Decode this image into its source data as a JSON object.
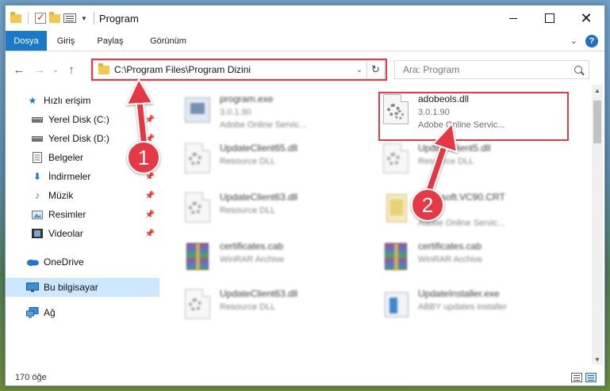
{
  "window": {
    "title": "Program",
    "controls": {
      "minimize": "",
      "maximize": "",
      "close": "✕"
    }
  },
  "ribbon": {
    "tabs": [
      "Dosya",
      "Giriş",
      "Paylaş",
      "Görünüm"
    ],
    "help": "?"
  },
  "nav": {
    "back": "←",
    "forward": "→",
    "recent": "⌄",
    "up": "↑",
    "address": "C:\\Program Files\\Program Dizini",
    "address_dropdown": "⌄",
    "refresh": "↻",
    "search_placeholder": "Ara: Program"
  },
  "sidebar": {
    "items": [
      {
        "label": "Hızlı erişim",
        "icon": "star-icon"
      },
      {
        "label": "Yerel Disk (C:)",
        "icon": "drive-icon",
        "pinned": true
      },
      {
        "label": "Yerel Disk (D:)",
        "icon": "drive-icon",
        "pinned": true
      },
      {
        "label": "Belgeler",
        "icon": "document-icon",
        "pinned": true
      },
      {
        "label": "İndirmeler",
        "icon": "download-icon",
        "pinned": true
      },
      {
        "label": "Müzik",
        "icon": "music-icon",
        "pinned": true
      },
      {
        "label": "Resimler",
        "icon": "pictures-icon",
        "pinned": true
      },
      {
        "label": "Videolar",
        "icon": "video-icon",
        "pinned": true
      },
      {
        "label": "OneDrive",
        "icon": "cloud-icon"
      },
      {
        "label": "Bu bilgisayar",
        "icon": "computer-icon",
        "selected": true
      },
      {
        "label": "Ağ",
        "icon": "network-icon"
      }
    ]
  },
  "files": [
    {
      "name": "program.exe",
      "line1": "3.0.1.90",
      "line2": "Adobe Online Servic...",
      "icon": "exe-icon",
      "blurred": true
    },
    {
      "name": "adobeols.dll",
      "line1": "3.0.1.90",
      "line2": "Adobe Online Servic...",
      "icon": "dll-gear-icon",
      "blurred": false
    },
    {
      "name": "UpdateClient65.dll",
      "line1": "Resource DLL",
      "line2": "",
      "icon": "dll-gear-icon",
      "blurred": true
    },
    {
      "name": "UpdateClient5.dll",
      "line1": "Resource DLL",
      "line2": "",
      "icon": "dll-gear-icon",
      "blurred": true
    },
    {
      "name": "UpdateClient63.dll",
      "line1": "Resource DLL",
      "line2": "",
      "icon": "dll-gear-icon",
      "blurred": true
    },
    {
      "name": "Microsoft.VC90.CRT",
      "line1": "3.0",
      "line2": "Adobe Online Servic...",
      "icon": "certificate-icon",
      "blurred": true
    },
    {
      "name": "certificates.cab",
      "line1": "WinRAR Archive",
      "line2": "",
      "icon": "winrar-icon",
      "blurred": true
    },
    {
      "name": "certificates.cab",
      "line1": "WinRAR Archive",
      "line2": "",
      "icon": "winrar-icon",
      "blurred": true
    },
    {
      "name": "UpdateClient63.dll",
      "line1": "Resource DLL",
      "line2": "",
      "icon": "dll-gear-icon",
      "blurred": true
    },
    {
      "name": "UpdateInstaller.exe",
      "line1": "ABBY updates installer",
      "line2": "",
      "icon": "installer-icon",
      "blurred": true
    }
  ],
  "annotations": {
    "badge1": "1",
    "badge2": "2",
    "color": "#e53945"
  },
  "status": {
    "item_count": "170 öğe"
  },
  "colors": {
    "accent": "#1979ca",
    "selection": "#cce8ff",
    "callout": "#e53945"
  }
}
